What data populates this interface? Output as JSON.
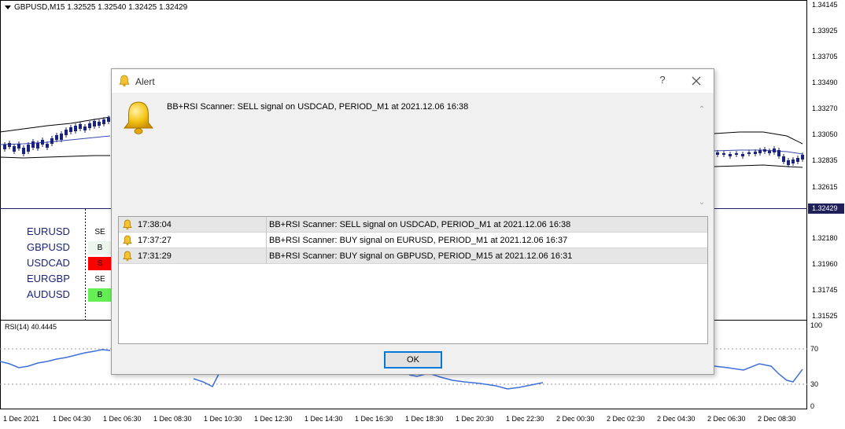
{
  "chart": {
    "symbol_header": "GBPUSD,M15  1.32525 1.32540 1.32425 1.32429",
    "current_price": "1.32429",
    "price_labels": [
      "1.34145",
      "1.33925",
      "1.33705",
      "1.33490",
      "1.33270",
      "1.33050",
      "1.32835",
      "1.32615",
      "1.32180",
      "1.31960",
      "1.31745",
      "1.31525"
    ],
    "time_labels": [
      "1 Dec 2021",
      "1 Dec 04:30",
      "1 Dec 06:30",
      "1 Dec 08:30",
      "1 Dec 10:30",
      "1 Dec 12:30",
      "1 Dec 14:30",
      "1 Dec 16:30",
      "1 Dec 18:30",
      "1 Dec 20:30",
      "1 Dec 22:30",
      "2 Dec 00:30",
      "2 Dec 02:30",
      "2 Dec 04:30",
      "2 Dec 06:30",
      "2 Dec 08:30"
    ],
    "rsi_label": "RSI(14) 40.4445",
    "rsi_levels": [
      "100",
      "70",
      "30",
      "0"
    ],
    "colors": {
      "candle": "#1a237e",
      "band": "#000000",
      "middle_band": "#3949ab",
      "rsi_line": "#3f6fd8",
      "current_price_bg": "#1f1f5a"
    }
  },
  "scanner": {
    "rows": [
      {
        "symbol": "EURUSD",
        "signal": "SE",
        "color": "#ffffff"
      },
      {
        "symbol": "GBPUSD",
        "signal": "B",
        "color": "#ecf6ec"
      },
      {
        "symbol": "USDCAD",
        "signal": "S",
        "color": "#ff0000"
      },
      {
        "symbol": "EURGBP",
        "signal": "SE",
        "color": "#ffffff"
      },
      {
        "symbol": "AUDUSD",
        "signal": "B",
        "color": "#66ee55"
      }
    ]
  },
  "dialog": {
    "title": "Alert",
    "help_label": "?",
    "message": "BB+RSI Scanner: SELL signal on USDCAD, PERIOD_M1 at 2021.12.06 16:38",
    "alerts": [
      {
        "time": "17:38:04",
        "message": "BB+RSI Scanner: SELL signal on USDCAD, PERIOD_M1 at 2021.12.06 16:38"
      },
      {
        "time": "17:37:27",
        "message": "BB+RSI Scanner: BUY signal on EURUSD, PERIOD_M1 at 2021.12.06 16:37"
      },
      {
        "time": "17:31:29",
        "message": "BB+RSI Scanner: BUY signal on GBPUSD, PERIOD_M15 at 2021.12.06 16:31"
      }
    ],
    "ok_label": "OK",
    "icons": {
      "title": "bell-icon",
      "message": "bell-icon",
      "row": "bell-icon",
      "close": "close-icon"
    }
  }
}
